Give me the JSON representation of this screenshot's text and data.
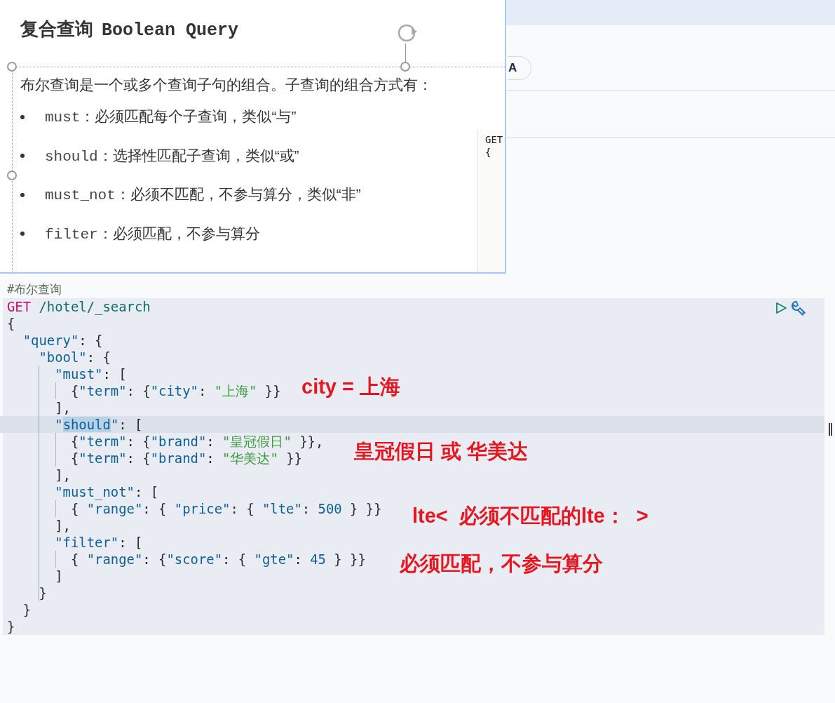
{
  "background": {
    "pill_button": "A"
  },
  "slide": {
    "title": "复合查询",
    "title_code": "Boolean Query",
    "intro": "布尔查询是一个或多个查询子句的组合。子查询的组合方式有：",
    "bullets": [
      {
        "term": "must",
        "text": "：必须匹配每个子查询，类似“与”"
      },
      {
        "term": "should",
        "text": "：选择性匹配子查询，类似“或”"
      },
      {
        "term": "must_not",
        "text": "：必须不匹配，不参与算分，类似“非”"
      },
      {
        "term": "filter",
        "text": "：必须匹配，不参与算分"
      }
    ],
    "fragment": [
      "GET",
      "{"
    ]
  },
  "editor": {
    "comment": "#布尔查询",
    "lines": [
      {
        "current": false,
        "tokens": [
          {
            "kind": "method",
            "text": "GET"
          },
          {
            "kind": "path",
            "text": " /hotel/_search"
          }
        ]
      },
      {
        "current": false,
        "tokens": [
          {
            "kind": "punct",
            "text": "{"
          }
        ]
      },
      {
        "current": false,
        "tokens": [
          {
            "kind": "key",
            "text": "  \"query\""
          },
          {
            "kind": "punct",
            "text": ": {"
          }
        ]
      },
      {
        "current": false,
        "tokens": [
          {
            "kind": "key",
            "text": "    \"bool\""
          },
          {
            "kind": "punct",
            "text": ": {"
          }
        ]
      },
      {
        "current": false,
        "tokens": [
          {
            "kind": "key",
            "text": "      \"must\""
          },
          {
            "kind": "punct",
            "text": ": ["
          }
        ]
      },
      {
        "current": false,
        "tokens": [
          {
            "kind": "punct",
            "text": "        {"
          },
          {
            "kind": "key",
            "text": "\"term\""
          },
          {
            "kind": "punct",
            "text": ": {"
          },
          {
            "kind": "key",
            "text": "\"city\""
          },
          {
            "kind": "punct",
            "text": ": "
          },
          {
            "kind": "string",
            "text": "\"上海\""
          },
          {
            "kind": "punct",
            "text": " }}"
          }
        ]
      },
      {
        "current": false,
        "tokens": [
          {
            "kind": "punct",
            "text": "      ],"
          }
        ]
      },
      {
        "current": true,
        "tokens": [
          {
            "kind": "key",
            "text": "      \""
          },
          {
            "kind": "selected",
            "text": "should"
          },
          {
            "kind": "key",
            "text": "\""
          },
          {
            "kind": "punct",
            "text": ": ["
          }
        ]
      },
      {
        "current": false,
        "tokens": [
          {
            "kind": "punct",
            "text": "        {"
          },
          {
            "kind": "key",
            "text": "\"term\""
          },
          {
            "kind": "punct",
            "text": ": {"
          },
          {
            "kind": "key",
            "text": "\"brand\""
          },
          {
            "kind": "punct",
            "text": ": "
          },
          {
            "kind": "string",
            "text": "\"皇冠假日\""
          },
          {
            "kind": "punct",
            "text": " }},"
          }
        ]
      },
      {
        "current": false,
        "tokens": [
          {
            "kind": "punct",
            "text": "        {"
          },
          {
            "kind": "key",
            "text": "\"term\""
          },
          {
            "kind": "punct",
            "text": ": {"
          },
          {
            "kind": "key",
            "text": "\"brand\""
          },
          {
            "kind": "punct",
            "text": ": "
          },
          {
            "kind": "string",
            "text": "\"华美达\""
          },
          {
            "kind": "punct",
            "text": " }}"
          }
        ]
      },
      {
        "current": false,
        "tokens": [
          {
            "kind": "punct",
            "text": "      ],"
          }
        ]
      },
      {
        "current": false,
        "tokens": [
          {
            "kind": "key",
            "text": "      \"must_not\""
          },
          {
            "kind": "punct",
            "text": ": ["
          }
        ]
      },
      {
        "current": false,
        "tokens": [
          {
            "kind": "punct",
            "text": "        { "
          },
          {
            "kind": "key",
            "text": "\"range\""
          },
          {
            "kind": "punct",
            "text": ": { "
          },
          {
            "kind": "key",
            "text": "\"price\""
          },
          {
            "kind": "punct",
            "text": ": { "
          },
          {
            "kind": "key",
            "text": "\"lte\""
          },
          {
            "kind": "punct",
            "text": ": "
          },
          {
            "kind": "number",
            "text": "500"
          },
          {
            "kind": "punct",
            "text": " } }}"
          }
        ]
      },
      {
        "current": false,
        "tokens": [
          {
            "kind": "punct",
            "text": "      ],"
          }
        ]
      },
      {
        "current": false,
        "tokens": [
          {
            "kind": "key",
            "text": "      \"filter\""
          },
          {
            "kind": "punct",
            "text": ": ["
          }
        ]
      },
      {
        "current": false,
        "tokens": [
          {
            "kind": "punct",
            "text": "        { "
          },
          {
            "kind": "key",
            "text": "\"range\""
          },
          {
            "kind": "punct",
            "text": ": {"
          },
          {
            "kind": "key",
            "text": "\"score\""
          },
          {
            "kind": "punct",
            "text": ": { "
          },
          {
            "kind": "key",
            "text": "\"gte\""
          },
          {
            "kind": "punct",
            "text": ": "
          },
          {
            "kind": "number",
            "text": "45"
          },
          {
            "kind": "punct",
            "text": " } }}"
          }
        ]
      },
      {
        "current": false,
        "tokens": [
          {
            "kind": "punct",
            "text": "      ]"
          }
        ]
      },
      {
        "current": false,
        "tokens": [
          {
            "kind": "punct",
            "text": "    }"
          }
        ]
      },
      {
        "current": false,
        "tokens": [
          {
            "kind": "punct",
            "text": "  }"
          }
        ]
      },
      {
        "current": false,
        "tokens": [
          {
            "kind": "punct",
            "text": "}"
          }
        ]
      }
    ]
  },
  "annotations": [
    "city = 上海",
    "皇冠假日 或 华美达",
    "lte<  必须不匹配的lte：  >",
    "必须匹配，不参与算分"
  ]
}
